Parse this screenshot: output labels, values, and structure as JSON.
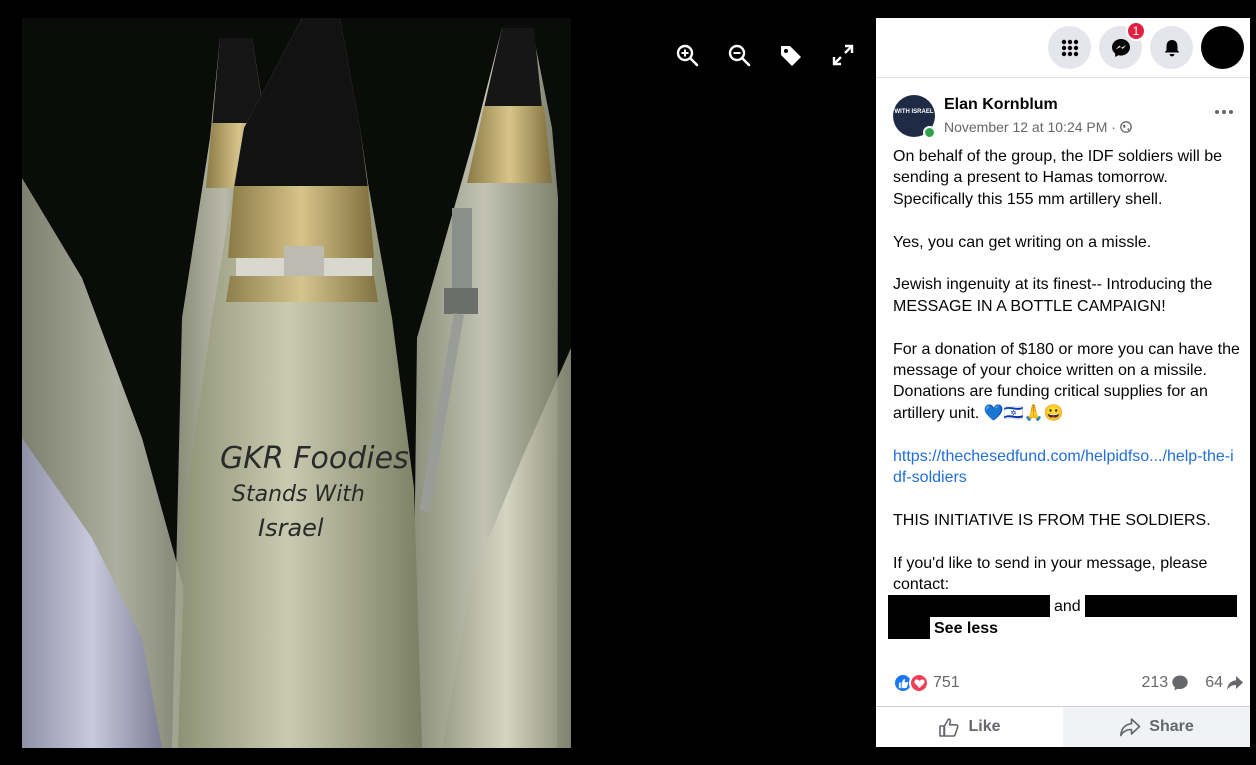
{
  "viewer": {
    "tools": [
      {
        "icon": "zoom-in-icon"
      },
      {
        "icon": "zoom-out-icon"
      },
      {
        "icon": "tag-icon"
      },
      {
        "icon": "fullscreen-icon"
      }
    ],
    "photo_text": {
      "line1": "GKR Foodies",
      "line2": "Stands With",
      "line3": "Israel"
    }
  },
  "topbar": {
    "menu_icon": "grid-menu-icon",
    "messenger_icon": "messenger-icon",
    "messenger_badge": "1",
    "notifications_icon": "bell-icon"
  },
  "post": {
    "author": "Elan Kornblum",
    "avatar_text": "WITH ISRAEL",
    "timestamp": "November 12 at 10:24 PM ·",
    "privacy_icon": "globe-icon",
    "paragraphs": {
      "p1": "On behalf of the group, the IDF soldiers will be sending a present to Hamas tomorrow. Specifically this 155 mm artillery shell.",
      "p2": "Yes, you can get writing on a missle.",
      "p3": "Jewish ingenuity at its finest-- Introducing the MESSAGE IN A BOTTLE CAMPAIGN!",
      "p4": "For a donation of $180 or more you can have the message of your choice written on a missile. Donations are funding critical supplies for an artillery unit. 💙🇮🇱🙏😀",
      "link": "https://thechesedfund.com/helpidfso.../help-the-idf-soldiers",
      "p5": "THIS INITIATIVE IS FROM THE SOLDIERS.",
      "p6": "If you'd like to send in your message, please contact:",
      "and": "and",
      "see_less": "See less"
    }
  },
  "stats": {
    "reactions_count": "751",
    "comments_count": "213",
    "shares_count": "64"
  },
  "actions": {
    "like": "Like",
    "share": "Share"
  },
  "colors": {
    "link": "#216fdb",
    "like_blue": "#1877f2",
    "love_red": "#f33e58",
    "online_green": "#31a24c",
    "badge_red": "#e41e3f"
  }
}
